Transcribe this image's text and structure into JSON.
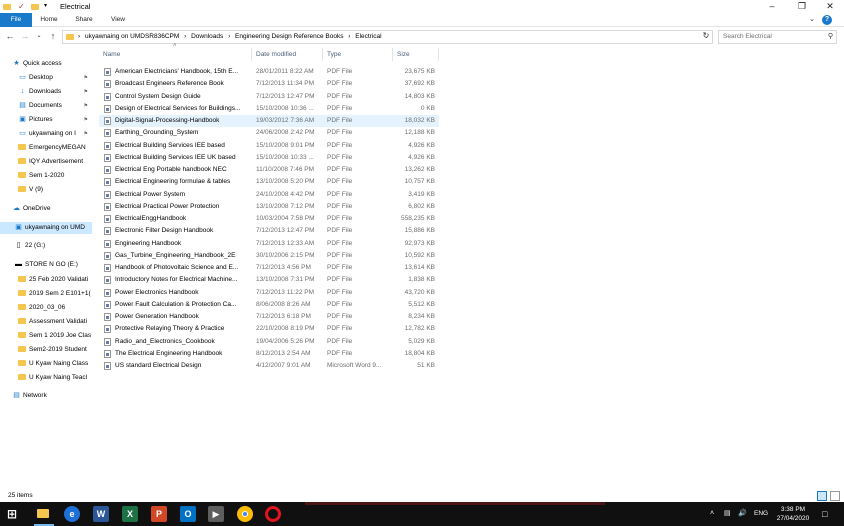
{
  "window": {
    "title": "Electrical"
  },
  "ribbon": {
    "tabs": [
      "File",
      "Home",
      "Share",
      "View"
    ]
  },
  "address": {
    "crumbs": [
      "ukyawnaing on UMDSR836CPM",
      "Downloads",
      "Engineering Design Reference Books",
      "Electrical"
    ],
    "search_placeholder": "Search Electrical"
  },
  "columns": {
    "name": "Name",
    "date": "Date modified",
    "type": "Type",
    "size": "Size"
  },
  "nav": {
    "quick_access": "Quick access",
    "pinned": [
      "Desktop",
      "Downloads",
      "Documents",
      "Pictures",
      "ukyawnaing on I"
    ],
    "folders": [
      "EmergencyMEGAN",
      "IQY Advertisement",
      "Sem 1-2020",
      "V (9)"
    ],
    "onedrive": "OneDrive",
    "this_pc": "ukyawnaing on UMD",
    "drive_g": "22 (G:)",
    "drive_e": "STORE N GO (E:)",
    "drive_e_folders": [
      "25 Feb 2020 Validati",
      "2019 Sem 2 E101+1(",
      "2020_03_06",
      "Assessment Validati",
      "Sem 1 2019 Joe Clas",
      "Sem2-2019 Student",
      "U Kyaw Naing Class",
      "U Kyaw Naing Teacl"
    ],
    "network": "Network"
  },
  "files": [
    {
      "name": "American Electricians' Handbook, 15th E...",
      "date": "28/01/2011 8:22 AM",
      "type": "PDF File",
      "size": "23,675 KB"
    },
    {
      "name": "Broadcast Engineers Reference Book",
      "date": "7/12/2013 11:34 PM",
      "type": "PDF File",
      "size": "37,692 KB"
    },
    {
      "name": "Control System Design Guide",
      "date": "7/12/2013 12:47 PM",
      "type": "PDF File",
      "size": "14,803 KB"
    },
    {
      "name": "Design of Electrical Services for Buildings...",
      "date": "15/10/2008 10:36 ...",
      "type": "PDF File",
      "size": "0 KB"
    },
    {
      "name": "Digital-Signal-Processing-Handbook",
      "date": "19/03/2012 7:36 AM",
      "type": "PDF File",
      "size": "18,032 KB"
    },
    {
      "name": "Earthing_Grounding_System",
      "date": "24/06/2008 2:42 PM",
      "type": "PDF File",
      "size": "12,188 KB"
    },
    {
      "name": "Electrical Building Services IEE based",
      "date": "15/10/2008 9:01 PM",
      "type": "PDF File",
      "size": "4,926 KB"
    },
    {
      "name": "Electrical Building Services IEE UK based",
      "date": "15/10/2008 10:33 ...",
      "type": "PDF File",
      "size": "4,926 KB"
    },
    {
      "name": "Electrical Eng Portable handbook NEC",
      "date": "11/10/2008 7:46 PM",
      "type": "PDF File",
      "size": "13,262 KB"
    },
    {
      "name": "Electrical Engineering formulae & tables",
      "date": "13/10/2008 5:20 PM",
      "type": "PDF File",
      "size": "10,757 KB"
    },
    {
      "name": "Electrical Power System",
      "date": "24/10/2008 4:42 PM",
      "type": "PDF File",
      "size": "3,419 KB"
    },
    {
      "name": "Electrical Practical Power Protection",
      "date": "13/10/2008 7:12 PM",
      "type": "PDF File",
      "size": "6,802 KB"
    },
    {
      "name": "ElectricalEnggHandbook",
      "date": "10/03/2004 7:58 PM",
      "type": "PDF File",
      "size": "558,235 KB"
    },
    {
      "name": "Electronic Filter Design Handbook",
      "date": "7/12/2013 12:47 PM",
      "type": "PDF File",
      "size": "15,886 KB"
    },
    {
      "name": "Engineering Handbook",
      "date": "7/12/2013 12:33 AM",
      "type": "PDF File",
      "size": "92,973 KB"
    },
    {
      "name": "Gas_Turbine_Engineering_Handbook_2E",
      "date": "30/10/2006 2:15 PM",
      "type": "PDF File",
      "size": "10,592 KB"
    },
    {
      "name": "Handbook of Photovoltaic Science and E...",
      "date": "7/12/2013 4:56 PM",
      "type": "PDF File",
      "size": "13,614 KB"
    },
    {
      "name": "Introductory Notes for Electrical Machine...",
      "date": "13/10/2008 7:31 PM",
      "type": "PDF File",
      "size": "1,838 KB"
    },
    {
      "name": "Power Electronics Handbook",
      "date": "7/12/2013 11:22 PM",
      "type": "PDF File",
      "size": "43,720 KB"
    },
    {
      "name": "Power Fault Calculation & Protection Ca...",
      "date": "8/06/2008 8:26 AM",
      "type": "PDF File",
      "size": "5,512 KB"
    },
    {
      "name": "Power Generation Handbook",
      "date": "7/12/2013 6:18 PM",
      "type": "PDF File",
      "size": "8,234 KB"
    },
    {
      "name": "Protective Relaying Theory & Practice",
      "date": "22/10/2008 8:19 PM",
      "type": "PDF File",
      "size": "12,782 KB"
    },
    {
      "name": "Radio_and_Electronics_Cookbook",
      "date": "19/04/2006 5:26 PM",
      "type": "PDF File",
      "size": "5,029 KB"
    },
    {
      "name": "The Electrical Engineering Handbook",
      "date": "8/12/2013 2:54 AM",
      "type": "PDF File",
      "size": "18,804 KB"
    },
    {
      "name": "US standard Electrical Design",
      "date": "4/12/2007 9:01 AM",
      "type": "Microsoft Word 9...",
      "size": "51 KB"
    }
  ],
  "status": {
    "count": "25 items"
  },
  "taskbar": {
    "lang": "ENG",
    "time": "3:38 PM",
    "date": "27/04/2020"
  },
  "colors": {
    "accent": "#1979ca",
    "selection": "#cce8ff",
    "hover": "#e5f3ff",
    "taskbar": "#101010"
  },
  "highlighted_row": 4
}
